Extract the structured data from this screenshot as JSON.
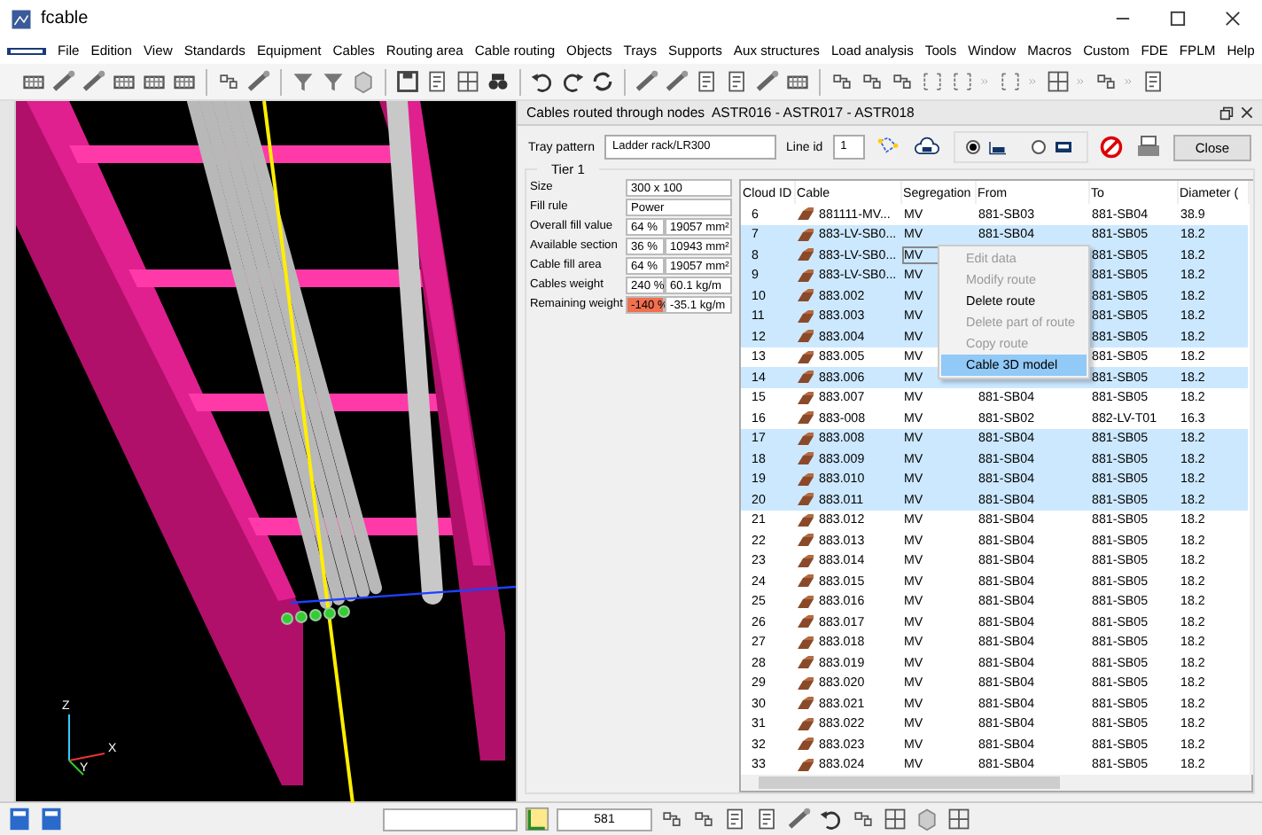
{
  "window": {
    "title": "fcable"
  },
  "menu": [
    "File",
    "Edition",
    "View",
    "Standards",
    "Equipment",
    "Cables",
    "Routing area",
    "Cable routing",
    "Objects",
    "Trays",
    "Supports",
    "Aux structures",
    "Load analysis",
    "Tools",
    "Window",
    "Macros",
    "Custom",
    "FDE",
    "FPLM",
    "Help"
  ],
  "viewport": {
    "axes": [
      "Z",
      "X",
      "Y"
    ]
  },
  "panel": {
    "title": "Cables routed through nodes  ASTR016 - ASTR017 - ASTR018",
    "tray_pattern": {
      "label": "Tray pattern",
      "value": "Ladder rack/LR300"
    },
    "line_id": {
      "label": "Line id",
      "value": "1"
    },
    "view_options": [
      {
        "selected": true
      },
      {
        "selected": false
      }
    ],
    "close_button": "Close",
    "tier": {
      "title": "Tier 1",
      "size": {
        "label": "Size",
        "value": "300 x 100"
      },
      "fill_rule": {
        "label": "Fill rule",
        "value": "Power"
      },
      "stats": [
        {
          "label": "Overall fill value",
          "percent": "64 %",
          "value": "19057 mm²",
          "warning": false
        },
        {
          "label": "Available section",
          "percent": "36 %",
          "value": "10943 mm²",
          "warning": false
        },
        {
          "label": "Cable fill area",
          "percent": "64 %",
          "value": "19057 mm²",
          "warning": false
        },
        {
          "label": "Cables weight",
          "percent": "240 %",
          "value": "60.1 kg/m",
          "warning": false
        },
        {
          "label": "Remaining weight",
          "percent": "-140 %",
          "value": "-35.1 kg/m",
          "warning": true
        }
      ]
    },
    "table": {
      "columns": [
        "Cloud ID",
        "Cable",
        "Segregation",
        "From",
        "To",
        "Diameter ("
      ],
      "rows": [
        {
          "cloud_id": "6",
          "cable": "881111-MV...",
          "segregation": "MV",
          "from": "881-SB03",
          "to": "881-SB04",
          "diameter": "38.9",
          "selected": false,
          "focused": false
        },
        {
          "cloud_id": "7",
          "cable": "883-LV-SB0...",
          "segregation": "MV",
          "from": "881-SB04",
          "to": "881-SB05",
          "diameter": "18.2",
          "selected": true,
          "focused": false
        },
        {
          "cloud_id": "8",
          "cable": "883-LV-SB0...",
          "segregation": "MV",
          "from": "",
          "to": "881-SB05",
          "diameter": "18.2",
          "selected": true,
          "focused": true
        },
        {
          "cloud_id": "9",
          "cable": "883-LV-SB0...",
          "segregation": "MV",
          "from": "",
          "to": "881-SB05",
          "diameter": "18.2",
          "selected": true,
          "focused": false
        },
        {
          "cloud_id": "10",
          "cable": "883.002",
          "segregation": "MV",
          "from": "",
          "to": "881-SB05",
          "diameter": "18.2",
          "selected": true,
          "focused": false
        },
        {
          "cloud_id": "11",
          "cable": "883.003",
          "segregation": "MV",
          "from": "",
          "to": "881-SB05",
          "diameter": "18.2",
          "selected": true,
          "focused": false
        },
        {
          "cloud_id": "12",
          "cable": "883.004",
          "segregation": "MV",
          "from": "",
          "to": "881-SB05",
          "diameter": "18.2",
          "selected": true,
          "focused": false
        },
        {
          "cloud_id": "13",
          "cable": "883.005",
          "segregation": "MV",
          "from": "",
          "to": "881-SB05",
          "diameter": "18.2",
          "selected": false,
          "focused": false
        },
        {
          "cloud_id": "14",
          "cable": "883.006",
          "segregation": "MV",
          "from": "",
          "to": "881-SB05",
          "diameter": "18.2",
          "selected": true,
          "focused": false
        },
        {
          "cloud_id": "15",
          "cable": "883.007",
          "segregation": "MV",
          "from": "881-SB04",
          "to": "881-SB05",
          "diameter": "18.2",
          "selected": false,
          "focused": false
        },
        {
          "cloud_id": "16",
          "cable": "883-008",
          "segregation": "MV",
          "from": "881-SB02",
          "to": "882-LV-T01",
          "diameter": "16.3",
          "selected": false,
          "focused": false
        },
        {
          "cloud_id": "17",
          "cable": "883.008",
          "segregation": "MV",
          "from": "881-SB04",
          "to": "881-SB05",
          "diameter": "18.2",
          "selected": true,
          "focused": false
        },
        {
          "cloud_id": "18",
          "cable": "883.009",
          "segregation": "MV",
          "from": "881-SB04",
          "to": "881-SB05",
          "diameter": "18.2",
          "selected": true,
          "focused": false
        },
        {
          "cloud_id": "19",
          "cable": "883.010",
          "segregation": "MV",
          "from": "881-SB04",
          "to": "881-SB05",
          "diameter": "18.2",
          "selected": true,
          "focused": false
        },
        {
          "cloud_id": "20",
          "cable": "883.011",
          "segregation": "MV",
          "from": "881-SB04",
          "to": "881-SB05",
          "diameter": "18.2",
          "selected": true,
          "focused": false
        },
        {
          "cloud_id": "21",
          "cable": "883.012",
          "segregation": "MV",
          "from": "881-SB04",
          "to": "881-SB05",
          "diameter": "18.2",
          "selected": false,
          "focused": false
        },
        {
          "cloud_id": "22",
          "cable": "883.013",
          "segregation": "MV",
          "from": "881-SB04",
          "to": "881-SB05",
          "diameter": "18.2",
          "selected": false,
          "focused": false
        },
        {
          "cloud_id": "23",
          "cable": "883.014",
          "segregation": "MV",
          "from": "881-SB04",
          "to": "881-SB05",
          "diameter": "18.2",
          "selected": false,
          "focused": false
        },
        {
          "cloud_id": "24",
          "cable": "883.015",
          "segregation": "MV",
          "from": "881-SB04",
          "to": "881-SB05",
          "diameter": "18.2",
          "selected": false,
          "focused": false
        },
        {
          "cloud_id": "25",
          "cable": "883.016",
          "segregation": "MV",
          "from": "881-SB04",
          "to": "881-SB05",
          "diameter": "18.2",
          "selected": false,
          "focused": false
        },
        {
          "cloud_id": "26",
          "cable": "883.017",
          "segregation": "MV",
          "from": "881-SB04",
          "to": "881-SB05",
          "diameter": "18.2",
          "selected": false,
          "focused": false
        },
        {
          "cloud_id": "27",
          "cable": "883.018",
          "segregation": "MV",
          "from": "881-SB04",
          "to": "881-SB05",
          "diameter": "18.2",
          "selected": false,
          "focused": false
        },
        {
          "cloud_id": "28",
          "cable": "883.019",
          "segregation": "MV",
          "from": "881-SB04",
          "to": "881-SB05",
          "diameter": "18.2",
          "selected": false,
          "focused": false
        },
        {
          "cloud_id": "29",
          "cable": "883.020",
          "segregation": "MV",
          "from": "881-SB04",
          "to": "881-SB05",
          "diameter": "18.2",
          "selected": false,
          "focused": false
        },
        {
          "cloud_id": "30",
          "cable": "883.021",
          "segregation": "MV",
          "from": "881-SB04",
          "to": "881-SB05",
          "diameter": "18.2",
          "selected": false,
          "focused": false
        },
        {
          "cloud_id": "31",
          "cable": "883.022",
          "segregation": "MV",
          "from": "881-SB04",
          "to": "881-SB05",
          "diameter": "18.2",
          "selected": false,
          "focused": false
        },
        {
          "cloud_id": "32",
          "cable": "883.023",
          "segregation": "MV",
          "from": "881-SB04",
          "to": "881-SB05",
          "diameter": "18.2",
          "selected": false,
          "focused": false
        },
        {
          "cloud_id": "33",
          "cable": "883.024",
          "segregation": "MV",
          "from": "881-SB04",
          "to": "881-SB05",
          "diameter": "18.2",
          "selected": false,
          "focused": false
        }
      ]
    },
    "context_menu": [
      {
        "label": "Edit data",
        "disabled": true,
        "selected": false
      },
      {
        "label": "Modify route",
        "disabled": true,
        "selected": false
      },
      {
        "label": "Delete route",
        "disabled": false,
        "selected": false
      },
      {
        "label": "Delete part of route",
        "disabled": true,
        "selected": false
      },
      {
        "label": "Copy route",
        "disabled": true,
        "selected": false
      },
      {
        "label": "Cable 3D model",
        "disabled": false,
        "selected": true
      }
    ]
  },
  "status_bar": {
    "count": "581"
  }
}
